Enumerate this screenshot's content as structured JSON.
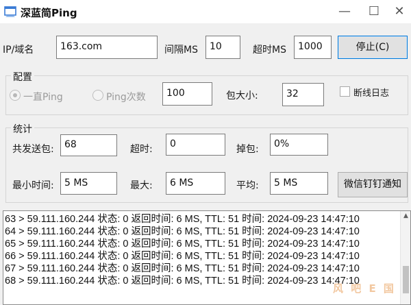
{
  "window": {
    "title": "深蓝简Ping",
    "icon": "app-window-icon",
    "controls": {
      "minimize": "—",
      "maximize": "☐",
      "close": "✕"
    }
  },
  "top": {
    "ip_label": "IP/域名",
    "ip_value": "163.com",
    "interval_label": "间隔MS",
    "interval_value": "10",
    "timeout_label": "超时MS",
    "timeout_value": "1000",
    "stop_button": "停止(C)"
  },
  "config": {
    "title": "配置",
    "radio_continuous": "一直Ping",
    "radio_count": "Ping次数",
    "count_value": "100",
    "packet_size_label": "包大小:",
    "packet_size_value": "32",
    "disconnect_log_label": "断线日志"
  },
  "stats": {
    "title": "统计",
    "sent_label": "共发送包:",
    "sent_value": "68",
    "timeout_label": "超时:",
    "timeout_value": "0",
    "lost_label": "掉包:",
    "lost_value": "0%",
    "min_label": "最小时间:",
    "min_value": "5 MS",
    "max_label": "最大:",
    "max_value": "6 MS",
    "avg_label": "平均:",
    "avg_value": "5 MS",
    "notify_button": "微信钉钉通知"
  },
  "log": {
    "lines": [
      "63 > 59.111.160.244 状态: 0 返回时间: 6 MS, TTL: 51 时间: 2024-09-23 14:47:10",
      "64 > 59.111.160.244 状态: 0 返回时间: 6 MS, TTL: 51 时间: 2024-09-23 14:47:10",
      "65 > 59.111.160.244 状态: 0 返回时间: 6 MS, TTL: 51 时间: 2024-09-23 14:47:10",
      "66 > 59.111.160.244 状态: 0 返回时间: 6 MS, TTL: 51 时间: 2024-09-23 14:47:10",
      "67 > 59.111.160.244 状态: 0 返回时间: 6 MS, TTL: 51 时间: 2024-09-23 14:47:10",
      "68 > 59.111.160.244 状态: 0 返回时间: 6 MS, TTL: 51 时间: 2024-09-23 14:47:10"
    ]
  },
  "watermark": "风 吧 E 国"
}
